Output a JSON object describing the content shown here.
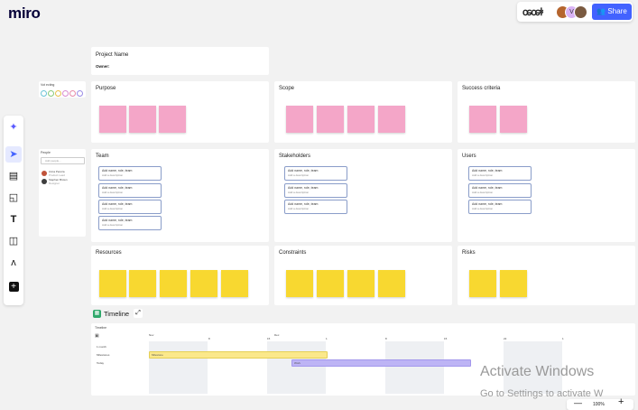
{
  "app": {
    "logo": "miro"
  },
  "topbar": {
    "collab_icon": "ꭀꭀꬸ",
    "avatar_v": "V",
    "share_label": "Share"
  },
  "header_card": {
    "project_name": "Project Name",
    "owner_label": "Owner:"
  },
  "vote_panel": {
    "title": "Vot ecting"
  },
  "people_panel": {
    "title": "People",
    "search_placeholder": "Add people...",
    "person1_name": "Anna Pereira",
    "person1_role": "Product Lead",
    "person2_name": "Stephen Brown",
    "person2_role": "Designer"
  },
  "sections": {
    "purpose": "Purpose",
    "scope": "Scope",
    "success": "Success criteria",
    "team": "Team",
    "stakeholders": "Stakeholders",
    "users": "Users",
    "resources": "Resources",
    "constraints": "Constraints",
    "risks": "Risks"
  },
  "persona_card": {
    "line1": "Add name, role, team",
    "line2": "Add a description"
  },
  "timeline": {
    "label": "Timeline",
    "frame_title": "Timeline",
    "row1": "1 month",
    "row2": "Milestones",
    "row3": "Today",
    "bar1": "Milestone",
    "bar2": "Work",
    "col_labels": [
      "Nov",
      "Dec"
    ],
    "day_labels": [
      "1",
      "8",
      "15",
      "1",
      "8",
      "15",
      "22",
      "1"
    ]
  },
  "zoom": {
    "level": "100%",
    "minus": "—",
    "plus": "+"
  },
  "watermark": {
    "line1": "Activate Windows",
    "line2": "Go to Settings to activate W"
  },
  "colors": {
    "accent": "#4262ff",
    "pink": "#f4a6c8",
    "yellow": "#f8d830",
    "timeline_yellow": "#fbe88b",
    "timeline_purple": "#bdb4f5"
  }
}
